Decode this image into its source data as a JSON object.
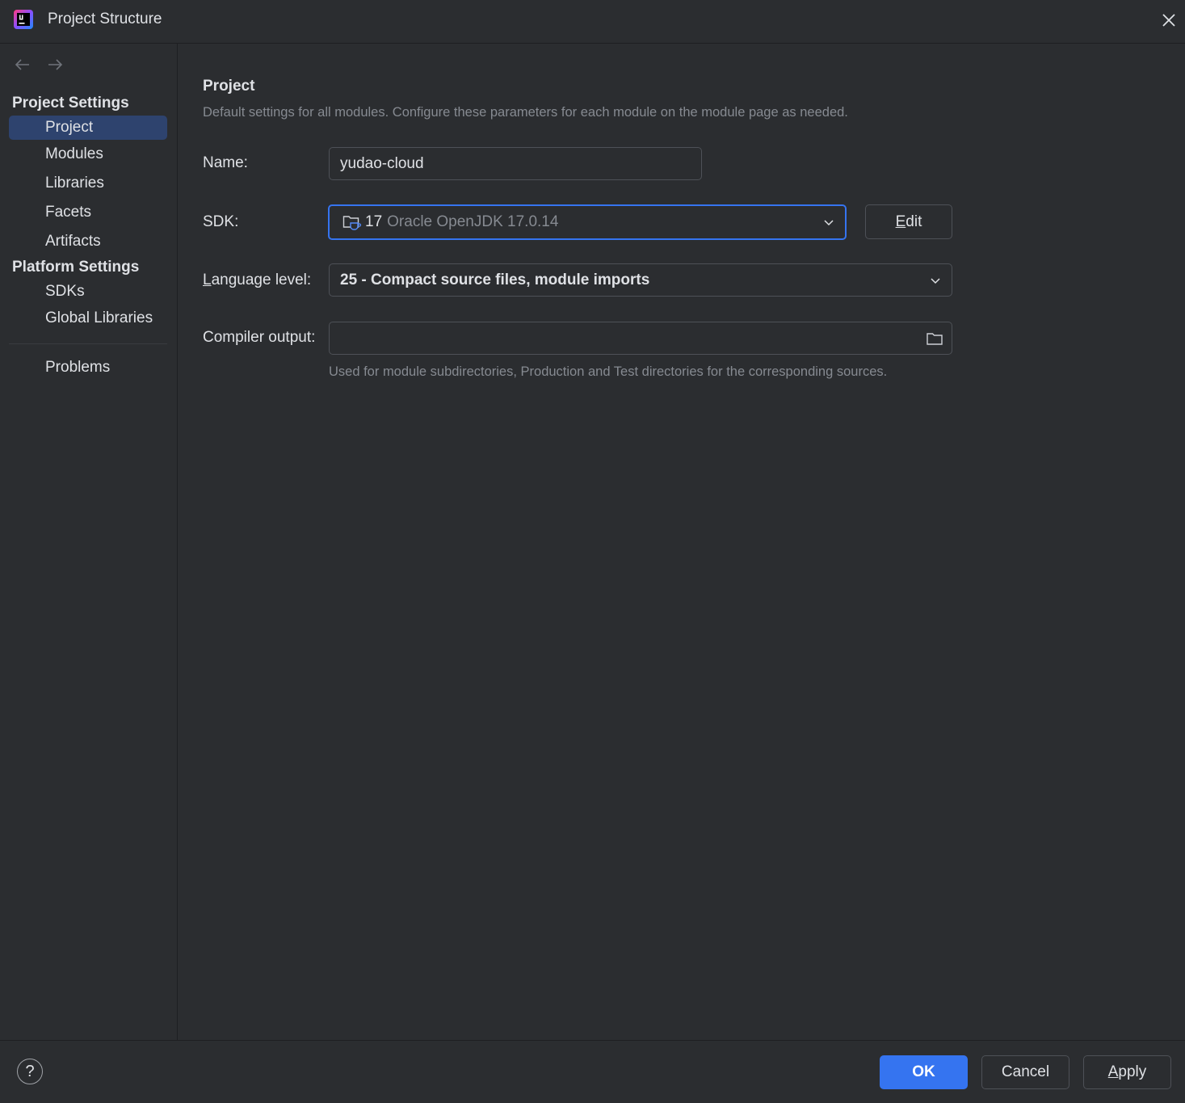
{
  "window": {
    "title": "Project Structure"
  },
  "sidebar": {
    "project_settings_header": "Project Settings",
    "platform_settings_header": "Platform Settings",
    "items": [
      {
        "label": "Project",
        "selected": true
      },
      {
        "label": "Modules"
      },
      {
        "label": "Libraries"
      },
      {
        "label": "Facets"
      },
      {
        "label": "Artifacts"
      },
      {
        "label": "SDKs"
      },
      {
        "label": "Global Libraries"
      },
      {
        "label": "Problems"
      }
    ]
  },
  "main": {
    "title": "Project",
    "description": "Default settings for all modules. Configure these parameters for each module on the module page as needed.",
    "name": {
      "label": "Name:",
      "value": "yudao-cloud"
    },
    "sdk": {
      "label": "SDK:",
      "version": "17",
      "detail": "Oracle OpenJDK 17.0.14",
      "edit_label_mnemonic": "E",
      "edit_label_rest": "dit"
    },
    "language_level": {
      "label_mnemonic": "L",
      "label_rest": "anguage level:",
      "value": "25 - Compact source files, module imports"
    },
    "compiler_output": {
      "label": "Compiler output:",
      "value": "",
      "hint": "Used for module subdirectories, Production and Test directories for the corresponding sources."
    }
  },
  "footer": {
    "help_label": "?",
    "ok_label": "OK",
    "cancel_label": "Cancel",
    "apply_mnemonic": "A",
    "apply_rest": "pply"
  },
  "colors": {
    "background": "#2b2d30",
    "accent": "#3574f0",
    "selection": "#2e436e",
    "muted_text": "#868a91"
  }
}
